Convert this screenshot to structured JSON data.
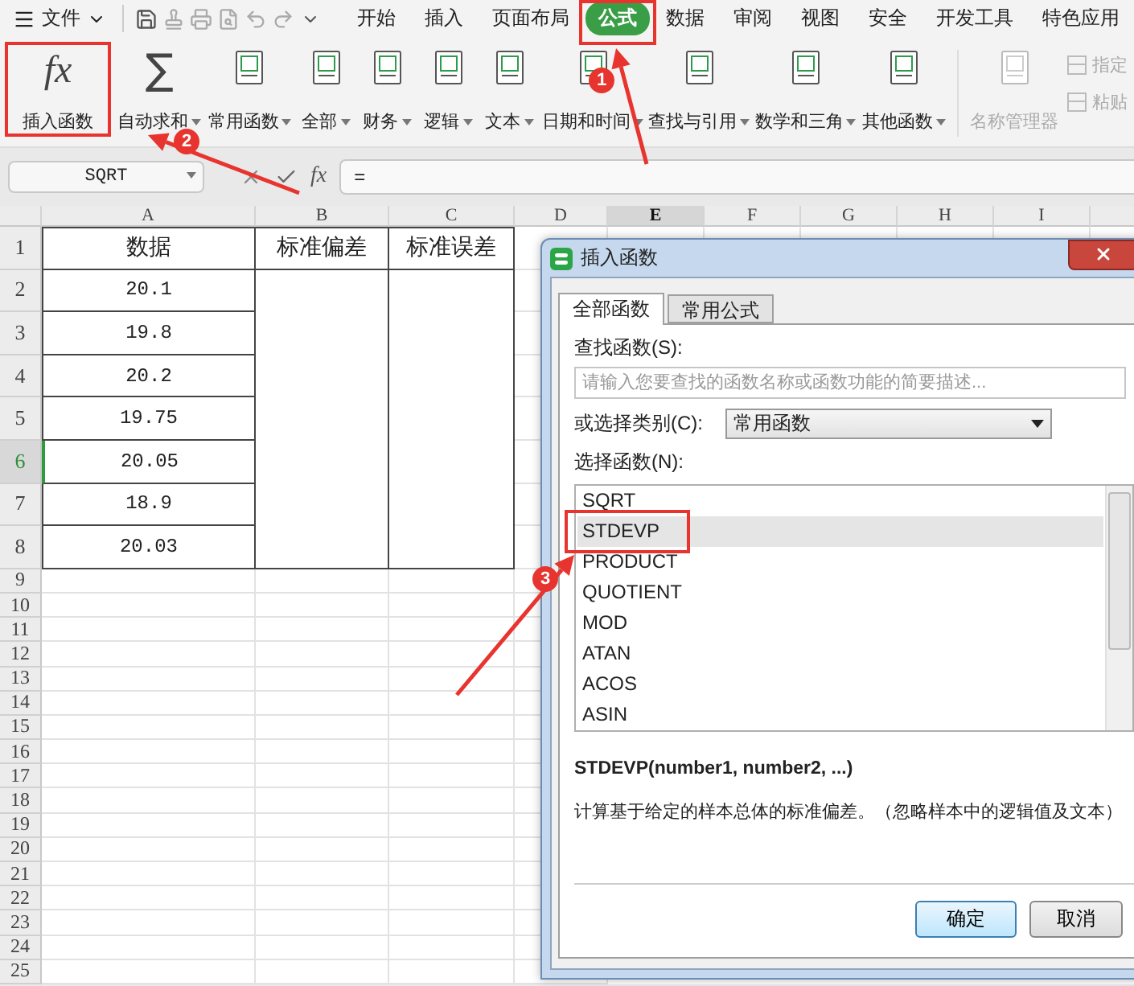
{
  "menu_bar": {
    "file_menu": "文件",
    "tabs": [
      {
        "label": "开始",
        "selected": false
      },
      {
        "label": "插入",
        "selected": false
      },
      {
        "label": "页面布局",
        "selected": false
      },
      {
        "label": "公式",
        "selected": true
      },
      {
        "label": "数据",
        "selected": false
      },
      {
        "label": "审阅",
        "selected": false
      },
      {
        "label": "视图",
        "selected": false
      },
      {
        "label": "安全",
        "selected": false
      },
      {
        "label": "开发工具",
        "selected": false
      },
      {
        "label": "特色应用",
        "selected": false
      }
    ]
  },
  "ribbon": {
    "tools": [
      {
        "label": "插入函数",
        "kind": "fx",
        "glyph": "fx",
        "dropdown": false,
        "disabled": false
      },
      {
        "label": "自动求和",
        "kind": "sigma",
        "glyph": "∑",
        "dropdown": true,
        "disabled": false
      },
      {
        "label": "常用函数",
        "kind": "book",
        "dropdown": true,
        "disabled": false
      },
      {
        "label": "全部",
        "kind": "book",
        "dropdown": true,
        "disabled": false
      },
      {
        "label": "财务",
        "kind": "book",
        "dropdown": true,
        "disabled": false
      },
      {
        "label": "逻辑",
        "kind": "book",
        "dropdown": true,
        "disabled": false
      },
      {
        "label": "文本",
        "kind": "book",
        "dropdown": true,
        "disabled": false
      },
      {
        "label": "日期和时间",
        "kind": "book",
        "dropdown": true,
        "disabled": false
      },
      {
        "label": "查找与引用",
        "kind": "book",
        "dropdown": true,
        "disabled": false
      },
      {
        "label": "数学和三角",
        "kind": "book",
        "dropdown": true,
        "disabled": false
      },
      {
        "label": "其他函数",
        "kind": "book",
        "dropdown": true,
        "disabled": false
      },
      {
        "label": "名称管理器",
        "kind": "book",
        "dropdown": false,
        "disabled": true
      }
    ],
    "small_tools": [
      {
        "label": "指定",
        "disabled": true
      },
      {
        "label": "粘贴",
        "disabled": true
      }
    ]
  },
  "formula_bar": {
    "name_box": "SQRT",
    "fx_label": "fx",
    "formula": "="
  },
  "sheet": {
    "columns": [
      {
        "label": "A",
        "selected": false
      },
      {
        "label": "B",
        "selected": false
      },
      {
        "label": "C",
        "selected": false
      },
      {
        "label": "D",
        "selected": false
      },
      {
        "label": "E",
        "selected": true
      },
      {
        "label": "F",
        "selected": false
      },
      {
        "label": "G",
        "selected": false
      },
      {
        "label": "H",
        "selected": false
      },
      {
        "label": "I",
        "selected": false
      }
    ],
    "rows": [
      {
        "number": "1",
        "selected": false,
        "cells": [
          "数据",
          "标准偏差",
          "标准误差"
        ]
      },
      {
        "number": "2",
        "selected": false,
        "cells": [
          "20.1"
        ]
      },
      {
        "number": "3",
        "selected": false,
        "cells": [
          "19.8"
        ]
      },
      {
        "number": "4",
        "selected": false,
        "cells": [
          "20.2"
        ]
      },
      {
        "number": "5",
        "selected": false,
        "cells": [
          "19.75"
        ]
      },
      {
        "number": "6",
        "selected": true,
        "cells": [
          "20.05"
        ]
      },
      {
        "number": "7",
        "selected": false,
        "cells": [
          "18.9"
        ]
      },
      {
        "number": "8",
        "selected": false,
        "cells": [
          "20.03"
        ]
      },
      {
        "number": "9",
        "selected": false
      },
      {
        "number": "10",
        "selected": false
      },
      {
        "number": "11",
        "selected": false
      },
      {
        "number": "12",
        "selected": false
      },
      {
        "number": "13",
        "selected": false
      },
      {
        "number": "14",
        "selected": false
      },
      {
        "number": "15",
        "selected": false
      },
      {
        "number": "16",
        "selected": false
      },
      {
        "number": "17",
        "selected": false
      },
      {
        "number": "18",
        "selected": false
      },
      {
        "number": "19",
        "selected": false
      },
      {
        "number": "20",
        "selected": false
      },
      {
        "number": "21",
        "selected": false
      },
      {
        "number": "22",
        "selected": false
      },
      {
        "number": "23",
        "selected": false
      },
      {
        "number": "24",
        "selected": false
      },
      {
        "number": "25",
        "selected": false
      }
    ]
  },
  "dialog": {
    "title": "插入函数",
    "tabs": [
      {
        "label": "全部函数",
        "selected": true
      },
      {
        "label": "常用公式",
        "selected": false
      }
    ],
    "search_label": "查找函数(S):",
    "search_placeholder": "请输入您要查找的函数名称或函数功能的简要描述...",
    "category_label": "或选择类别(C):",
    "category": "常用函数",
    "list_label": "选择函数(N):",
    "functions": [
      {
        "name": "SQRT",
        "selected": false
      },
      {
        "name": "STDEVP",
        "selected": true
      },
      {
        "name": "PRODUCT",
        "selected": false
      },
      {
        "name": "QUOTIENT",
        "selected": false
      },
      {
        "name": "MOD",
        "selected": false
      },
      {
        "name": "ATAN",
        "selected": false
      },
      {
        "name": "ACOS",
        "selected": false
      },
      {
        "name": "ASIN",
        "selected": false
      }
    ],
    "signature": "STDEVP(number1, number2, ...)",
    "description": "计算基于给定的样本总体的标准偏差。（忽略样本中的逻辑值及文本）",
    "buttons": [
      {
        "label": "确定",
        "kind": "primary"
      },
      {
        "label": "取消",
        "kind": "normal"
      }
    ]
  },
  "annotations": [
    {
      "step": "1"
    },
    {
      "step": "2"
    },
    {
      "step": "3"
    }
  ]
}
